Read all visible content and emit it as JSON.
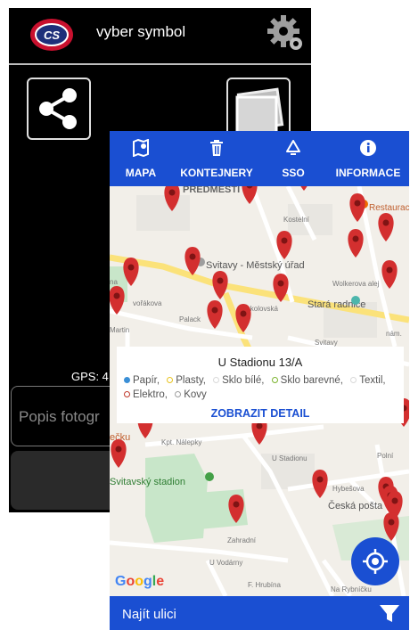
{
  "back_app": {
    "title": "vyber symbol",
    "gps_label": "GPS: 4",
    "description_placeholder": "Popis fotogr",
    "icons": [
      "app-logo-icon",
      "gear-icon",
      "share-icon",
      "photos-icon"
    ]
  },
  "front_app": {
    "tabs": [
      {
        "label": "MAPA",
        "icon": "map-icon"
      },
      {
        "label": "KONTEJNERY",
        "icon": "trash-icon"
      },
      {
        "label": "SSO",
        "icon": "recycle-icon"
      },
      {
        "label": "INFORMACE",
        "icon": "info-icon"
      }
    ],
    "map": {
      "labels": {
        "predmesti": "PŘEDMĚSTÍ",
        "svitavy_urad": "Svitavy - Městský úřad",
        "stara_radnice": "Stará radnice",
        "restaurace": "Restaurace Cook",
        "svitavsky_stadion": "Svitavský stadion",
        "ceska_posta": "Česká pošta",
        "stadion_street": "U Stadionu",
        "nalepky": "Kpt. Nálepky",
        "hybesova": "Hybešova",
        "zahradni": "Zahradní",
        "vodarny": "U Vodárny",
        "hrubina": "F. Hrubína",
        "rybnicek": "Na Rybníčku",
        "palacka": "Palack",
        "prokova": "vořákova",
        "martini": "Martin",
        "sokolovska": "Sokolovská",
        "volkova": "Wolkerova alej",
        "nam": "nám.",
        "svitavy_short": "Svitavy",
        "recku": "ečku",
        "na": "na",
        "poli": "Polní",
        "kostelni": "Kostelní"
      },
      "attribution": "Google"
    },
    "popup": {
      "title": "U Stadionu 13/A",
      "legend": [
        {
          "label": "Papír,",
          "color": "#3a8fd6",
          "filled": true
        },
        {
          "label": "Plasty,",
          "color": "#e8c420",
          "filled": false
        },
        {
          "label": "Sklo bílé,",
          "color": "#d9d9d9",
          "filled": false
        },
        {
          "label": "Sklo barevné,",
          "color": "#7bb32e",
          "filled": false
        },
        {
          "label": "Textil,",
          "color": "#d9d9d9",
          "filled": false
        },
        {
          "label": "Elektro,",
          "color": "#c0392b",
          "filled": false
        },
        {
          "label": "Kovy",
          "color": "#9e9e9e",
          "filled": false
        }
      ],
      "detail_label": "ZOBRAZIT DETAIL"
    },
    "bottom_bar": {
      "search_label": "Najít ulici",
      "filter_icon": "filter-icon"
    },
    "locate_button_icon": "locate-icon",
    "colors": {
      "primary": "#1a4fd2",
      "marker": "#d32f2f",
      "map_bg": "#f2efe9",
      "park": "#c8e6c9",
      "main_road": "#fbe27a"
    }
  }
}
